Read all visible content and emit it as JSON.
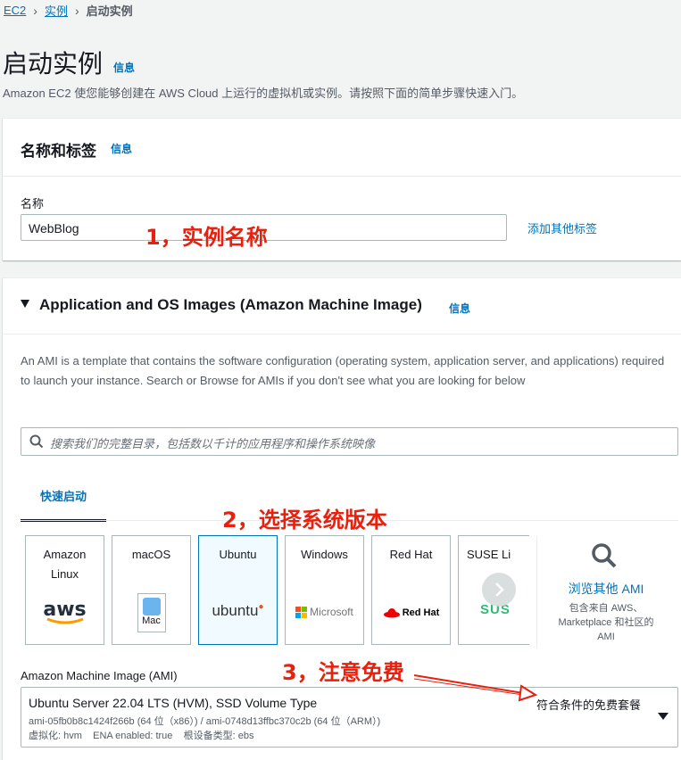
{
  "breadcrumb": {
    "root": "EC2",
    "parent": "实例",
    "current": "启动实例"
  },
  "page": {
    "title": "启动实例",
    "info": "信息",
    "subtitle": "Amazon EC2 使您能够创建在 AWS Cloud 上运行的虚拟机或实例。请按照下面的简单步骤快速入门。"
  },
  "name_tags": {
    "title": "名称和标签",
    "info": "信息",
    "name_label": "名称",
    "name_value": "WebBlog",
    "add_tags": "添加其他标签"
  },
  "ami_section": {
    "title": "Application and OS Images (Amazon Machine Image)",
    "info": "信息",
    "description": "An AMI is a template that contains the software configuration (operating system, application server, and applications) required to launch your instance. Search or Browse for AMIs if you don't see what you are looking for below",
    "search_placeholder": "搜索我们的完整目录，包括数以千计的应用程序和操作系统映像",
    "tab_label": "快速启动",
    "tiles": [
      {
        "name": "Amazon Linux",
        "logo": "aws"
      },
      {
        "name": "macOS",
        "logo": "Mac"
      },
      {
        "name": "Ubuntu",
        "logo": "ubuntu"
      },
      {
        "name": "Windows",
        "logo": "Microsoft"
      },
      {
        "name": "Red Hat",
        "logo": "Red Hat"
      },
      {
        "name": "SUSE Li",
        "logo": "SUS"
      }
    ],
    "browse_title": "浏览其他 AMI",
    "browse_desc": "包含来自 AWS、Marketplace 和社区的 AMI",
    "ami_label": "Amazon Machine Image (AMI)",
    "ami_name": "Ubuntu Server 22.04 LTS (HVM), SSD Volume Type",
    "ami_ids": "ami-05fb0b8c1424f266b (64 位（x86）) / ami-0748d13ffbc370c2b (64 位（ARM）)",
    "ami_meta": "虚拟化: hvm    ENA enabled: true    根设备类型: ebs",
    "free_tier": "符合条件的免费套餐"
  },
  "annotations": {
    "a1": "1，实例名称",
    "a2": "2，选择系统版本",
    "a3": "3，注意免费"
  },
  "colors": {
    "link": "#0073bb",
    "annotation": "#e8200d",
    "selected_tile_border": "#0073bb"
  }
}
